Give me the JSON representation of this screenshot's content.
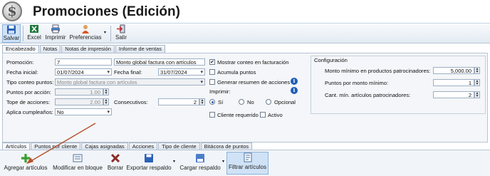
{
  "window": {
    "title": "Promociones (Edición)",
    "logo_symbol": "$"
  },
  "toolbar": [
    {
      "label": "Salvar",
      "icon": "save-icon"
    },
    {
      "label": "Excel",
      "icon": "excel-icon"
    },
    {
      "label": "Imprimir",
      "icon": "printer-icon"
    },
    {
      "label": "Preferencias",
      "icon": "preferences-icon"
    },
    {
      "label": "Salir",
      "icon": "exit-icon"
    }
  ],
  "top_tabs": [
    "Encabezado",
    "Notas",
    "Notas de impresión",
    "Informe de ventas"
  ],
  "form": {
    "promocion_label": "Promoción:",
    "promocion_value": "7",
    "descripcion_value": "Monto global factura con artículos",
    "fecha_inicial_label": "Fecha inicial:",
    "fecha_inicial_value": "01/07/2024",
    "fecha_final_label": "Fecha final:",
    "fecha_final_value": "31/07/2024",
    "tipo_conteo_label": "Tipo conteo puntos:",
    "tipo_conteo_value": "Monto global factura con artículos",
    "puntos_accion_label": "Puntos por acción:",
    "puntos_accion_value": "1.00",
    "tope_acciones_label": "Tope de acciones:",
    "tope_acciones_value": "2.00",
    "consecutivos_label": "Consecutivos:",
    "consecutivos_value": "2",
    "aplica_cumple_label": "Aplica cumpleaños:",
    "aplica_cumple_value": "No"
  },
  "options": {
    "mostrar_conteo": "Mostrar conteo en facturación",
    "acumula_puntos": "Acumula puntos",
    "generar_resumen": "Generar resumen de acciones",
    "imprimir_label": "Imprimir:",
    "radio_si": "Sí",
    "radio_no": "No",
    "radio_opcional": "Opcional",
    "cliente_requerido": "Cliente requerido",
    "activo": "Activo"
  },
  "config": {
    "title": "Configuración",
    "monto_minimo_label": "Monto mínimo en productos patrocinadores:",
    "monto_minimo_value": "5,000.00",
    "puntos_monto_label": "Puntos por monto mínimo:",
    "puntos_monto_value": "1",
    "cant_min_label": "Cant. mín. artículos patrocinadores:",
    "cant_min_value": "2"
  },
  "bottom_tabs": [
    "Artículos",
    "Puntos por cliente",
    "Cajas asignadas",
    "Acciones",
    "Tipo de cliente",
    "Bitácora de puntos"
  ],
  "bottom_toolbar": [
    {
      "label": "Agregar artículos",
      "icon": "add-icon"
    },
    {
      "label": "Modificar en bloque",
      "icon": "edit-block-icon"
    },
    {
      "label": "Borrar",
      "icon": "delete-icon"
    },
    {
      "label": "Exportar respaldo",
      "icon": "export-icon"
    },
    {
      "label": "Cargar respaldo",
      "icon": "load-icon"
    },
    {
      "label": "Filtrar artículos",
      "icon": "filter-icon"
    }
  ],
  "colors": {
    "annotation_arrow": "#b5502a",
    "accent": "#1f5fb5"
  }
}
